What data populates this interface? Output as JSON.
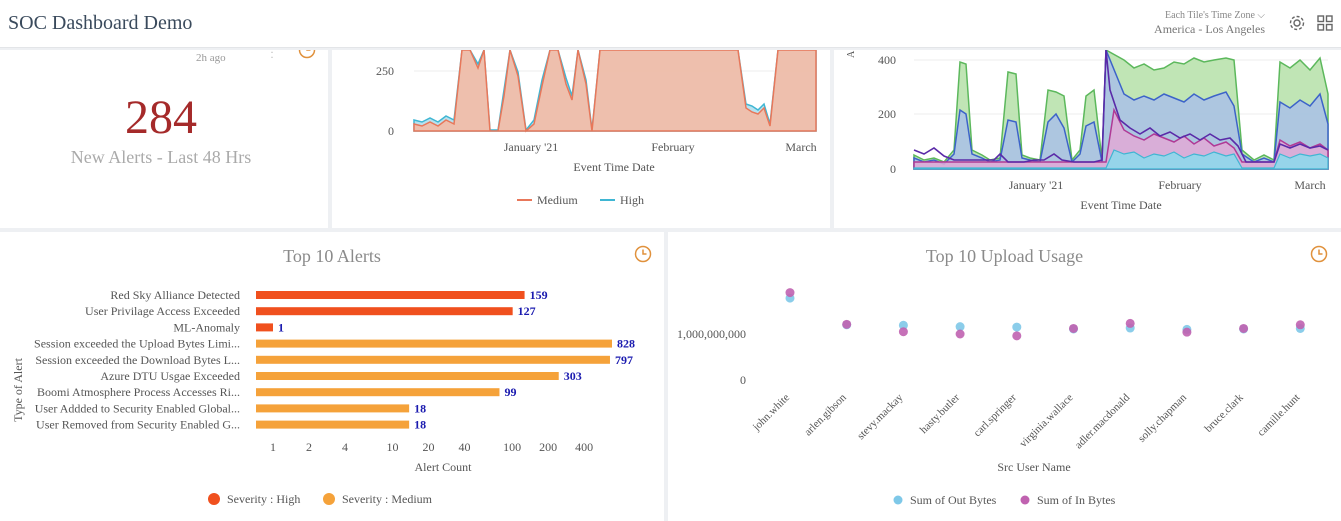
{
  "header": {
    "title": "SOC Dashboard Demo",
    "timezone_label": "Each Tile's Time Zone",
    "timezone_value": "America - Los Angeles",
    "icons": [
      "gear-icon",
      "grid-icon",
      "chevron-down-icon"
    ]
  },
  "kpi": {
    "updated": "2h ago",
    "value": "284",
    "label": "New Alerts - Last 48 Hrs",
    "color": "#a52a2a"
  },
  "area_chart_1": {
    "xlabel": "Event Time Date",
    "x_ticks": [
      "January '21",
      "February",
      "March"
    ],
    "y_ticks": [
      "0",
      "250"
    ],
    "legend": [
      "Medium",
      "High"
    ],
    "colors": {
      "Medium": "#e8775a",
      "High": "#3fb6d3"
    }
  },
  "area_chart_2": {
    "xlabel": "Event Time Date",
    "x_ticks": [
      "January '21",
      "February",
      "March"
    ],
    "y_ticks": [
      "0",
      "200",
      "400"
    ]
  },
  "alerts_tile": {
    "title": "Top 10 Alerts",
    "ylabel": "Type of Alert",
    "xlabel": "Alert Count",
    "x_ticks": [
      "1",
      "2",
      "4",
      "10",
      "20",
      "40",
      "100",
      "200",
      "400"
    ],
    "legend": [
      "Severity : High",
      "Severity : Medium"
    ]
  },
  "upload_tile": {
    "title": "Top 10 Upload Usage",
    "xlabel": "Src User Name",
    "y_ticks": [
      "0",
      "1,000,000,000"
    ],
    "legend": [
      "Sum of Out Bytes",
      "Sum of In Bytes"
    ]
  },
  "chart_data": [
    {
      "type": "bar",
      "title": "Top 10 Alerts",
      "xlabel": "Alert Count",
      "ylabel": "Type of Alert",
      "x_scale": "log",
      "categories": [
        "Red Sky Alliance Detected",
        "User Privilage Access Exceeded",
        "ML-Anomaly",
        "Session exceeded the Upload Bytes Limi...",
        "Session exceeded the Download Bytes L...",
        "Azure DTU Usgae Exceeded",
        "Boomi Atmosphere Process Accesses Ri...",
        "User Addded to Security Enabled Global...",
        "User Removed from Security Enabled G..."
      ],
      "values": [
        159,
        127,
        1,
        828,
        797,
        303,
        99,
        18,
        18
      ],
      "severity": [
        "High",
        "High",
        "High",
        "Medium",
        "Medium",
        "Medium",
        "Medium",
        "Medium",
        "Medium"
      ],
      "colors": {
        "High": "#f0501e",
        "Medium": "#f5a23a"
      }
    },
    {
      "type": "scatter",
      "title": "Top 10 Upload Usage",
      "xlabel": "Src User Name",
      "categories": [
        "john.white",
        "arlen.gibson",
        "stevy.mackay",
        "hasty.butler",
        "carl.springer",
        "virginia.wallace",
        "adler.macdonald",
        "solly.chapman",
        "bruce.clark",
        "camille.hunt"
      ],
      "series": [
        {
          "name": "Sum of Out Bytes",
          "values": [
            1780000000,
            1200000000,
            1190000000,
            1160000000,
            1150000000,
            1110000000,
            1130000000,
            1100000000,
            1110000000,
            1120000000
          ],
          "color": "#7ec8e8"
        },
        {
          "name": "Sum of In Bytes",
          "values": [
            1900000000,
            1210000000,
            1050000000,
            1000000000,
            960000000,
            1120000000,
            1230000000,
            1040000000,
            1120000000,
            1200000000
          ],
          "color": "#c062b0"
        }
      ],
      "ylim": [
        0,
        2000000000
      ]
    }
  ]
}
